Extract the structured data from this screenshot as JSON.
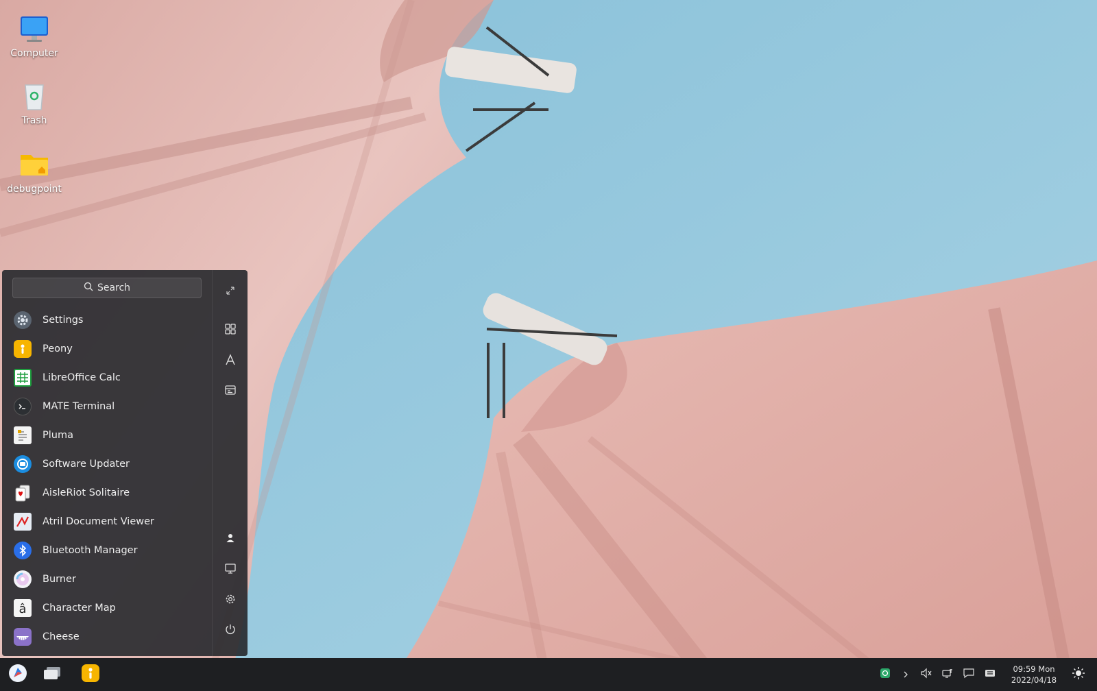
{
  "desktop": {
    "icons": [
      {
        "label": "Computer",
        "icon": "computer-icon"
      },
      {
        "label": "Trash",
        "icon": "trash-icon"
      },
      {
        "label": "debugpoint",
        "icon": "home-folder-icon"
      }
    ]
  },
  "menu": {
    "search_label": "Search",
    "apps": [
      {
        "label": "Settings",
        "icon": "settings-icon"
      },
      {
        "label": "Peony",
        "icon": "peony-icon"
      },
      {
        "label": "LibreOffice Calc",
        "icon": "libreoffice-calc-icon"
      },
      {
        "label": "MATE Terminal",
        "icon": "terminal-icon"
      },
      {
        "label": "Pluma",
        "icon": "pluma-icon"
      },
      {
        "label": "Software Updater",
        "icon": "software-updater-icon"
      },
      {
        "label": "AisleRiot Solitaire",
        "icon": "solitaire-icon"
      },
      {
        "label": "Atril Document Viewer",
        "icon": "atril-icon"
      },
      {
        "label": "Bluetooth Manager",
        "icon": "bluetooth-icon"
      },
      {
        "label": "Burner",
        "icon": "burner-icon"
      },
      {
        "label": "Character Map",
        "icon": "character-map-icon"
      },
      {
        "label": "Cheese",
        "icon": "cheese-icon"
      }
    ],
    "sidebar": [
      "expand-icon",
      "grid-view-icon",
      "letter-sort-icon",
      "category-icon",
      "user-icon",
      "computer-icon",
      "gear-icon",
      "power-icon"
    ]
  },
  "taskbar": {
    "clock_time": "09:59 Mon",
    "clock_date": "2022/04/18",
    "colors": {
      "background": "#1e1f22",
      "accent": "#3b82f6"
    }
  }
}
